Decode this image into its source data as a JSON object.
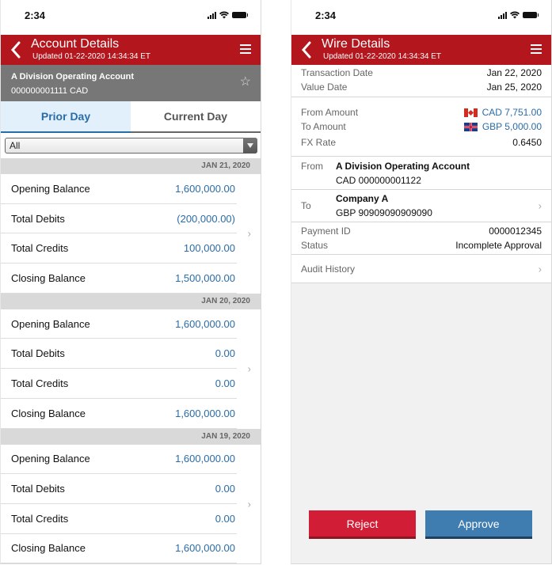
{
  "status_bar": {
    "time": "2:34"
  },
  "left_screen": {
    "title": "Account Details",
    "updated": "Updated  01-22-2020  14:34:34 ET",
    "account": {
      "name": "A Division Operating Account",
      "number": "000000001111 CAD"
    },
    "tabs": [
      {
        "label": "Prior Day",
        "active": true
      },
      {
        "label": "Current Day",
        "active": false
      }
    ],
    "filter": {
      "selected": "All"
    },
    "days": [
      {
        "date": "JAN 21, 2020",
        "rows": [
          {
            "label": "Opening Balance",
            "value": "1,600,000.00"
          },
          {
            "label": "Total Debits",
            "value": "(200,000.00)"
          },
          {
            "label": "Total Credits",
            "value": "100,000.00"
          },
          {
            "label": "Closing Balance",
            "value": "1,500,000.00"
          }
        ]
      },
      {
        "date": "JAN 20, 2020",
        "rows": [
          {
            "label": "Opening Balance",
            "value": "1,600,000.00"
          },
          {
            "label": "Total Debits",
            "value": "0.00"
          },
          {
            "label": "Total Credits",
            "value": "0.00"
          },
          {
            "label": "Closing Balance",
            "value": "1,600,000.00"
          }
        ]
      },
      {
        "date": "JAN 19, 2020",
        "rows": [
          {
            "label": "Opening Balance",
            "value": "1,600,000.00"
          },
          {
            "label": "Total Debits",
            "value": "0.00"
          },
          {
            "label": "Total Credits",
            "value": "0.00"
          },
          {
            "label": "Closing Balance",
            "value": "1,600,000.00"
          }
        ]
      }
    ]
  },
  "right_screen": {
    "title": "Wire Details",
    "updated": "Updated  01-22-2020  14:34:34 ET",
    "dates": [
      {
        "label": "Transaction Date",
        "value": "Jan 22, 2020"
      },
      {
        "label": "Value Date",
        "value": "Jan 25, 2020"
      }
    ],
    "amounts": {
      "from_label": "From Amount",
      "from_value": "CAD 7,751.00",
      "from_flag": "canada-flag",
      "to_label": "To Amount",
      "to_value": "GBP 5,000.00",
      "to_flag": "uk-flag",
      "fx_label": "FX Rate",
      "fx_value": "0.6450"
    },
    "from": {
      "label": "From",
      "name": "A Division Operating Account",
      "account": "CAD 000000001122"
    },
    "to": {
      "label": "To",
      "name": "Company A",
      "account": "GBP 90909090909090"
    },
    "payment": [
      {
        "label": "Payment ID",
        "value": "0000012345"
      },
      {
        "label": "Status",
        "value": "Incomplete Approval"
      }
    ],
    "audit_label": "Audit History",
    "buttons": {
      "reject": "Reject",
      "approve": "Approve"
    },
    "colors": {
      "reject": "#d11e36",
      "approve": "#3f7cb0",
      "header": "#b3161d",
      "link": "#2a6ca8"
    }
  }
}
